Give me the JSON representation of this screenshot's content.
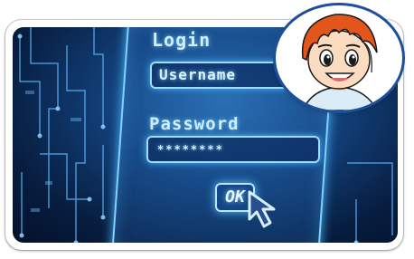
{
  "image": {
    "login_label": "Login",
    "username_text": "Username",
    "password_label": "Password",
    "password_mask": "********",
    "ok_label": "OK",
    "icons": [
      "mouse-cursor-icon",
      "avatar-icon"
    ],
    "colors": {
      "screen_blue": "#123f78",
      "glow": "#7fd4ff",
      "frame_border": "#1d4f9a",
      "hair": "#e2551b"
    }
  }
}
